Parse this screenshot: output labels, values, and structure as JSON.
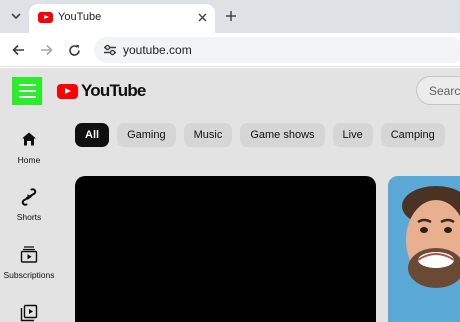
{
  "browser": {
    "tab": {
      "title": "YouTube",
      "favicon": "youtube-favicon"
    },
    "address_bar": {
      "url": "youtube.com"
    },
    "icons": {
      "tab_search": "chevron-down-icon",
      "tab_close": "close-icon",
      "new_tab": "plus-icon",
      "back": "arrow-left-icon",
      "forward": "arrow-right-icon",
      "reload": "reload-icon",
      "site_info": "tune-icon"
    }
  },
  "youtube": {
    "logo_text": "YouTube",
    "search_placeholder": "Search",
    "highlight_color": "#2aee2a",
    "brand_color": "#ff0000",
    "sidebar": [
      {
        "label": "Home",
        "icon": "home-icon"
      },
      {
        "label": "Shorts",
        "icon": "shorts-icon"
      },
      {
        "label": "Subscriptions",
        "icon": "subscriptions-icon"
      },
      {
        "label": "",
        "icon": "library-icon"
      }
    ],
    "chips": [
      "All",
      "Gaming",
      "Music",
      "Game shows",
      "Live",
      "Camping"
    ],
    "active_chip": "All"
  }
}
